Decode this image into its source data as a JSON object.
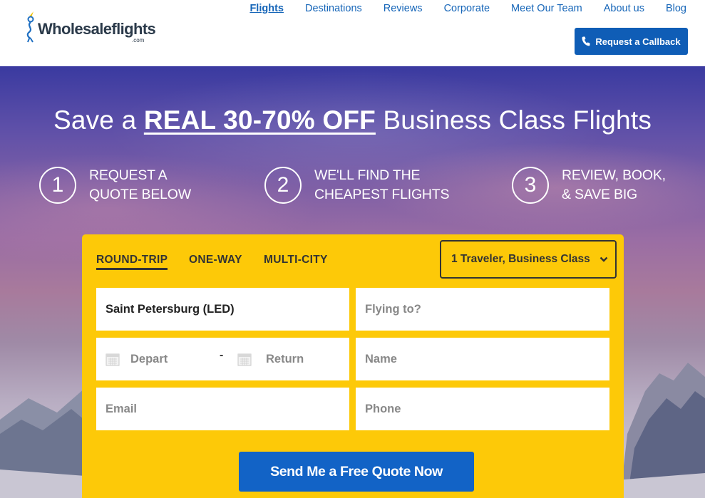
{
  "header": {
    "logo_text": "Wholesaleflights",
    "logo_sub": ".com",
    "nav": [
      {
        "label": "Flights",
        "active": true
      },
      {
        "label": "Destinations"
      },
      {
        "label": "Reviews"
      },
      {
        "label": "Corporate"
      },
      {
        "label": "Meet Our Team"
      },
      {
        "label": "About us"
      },
      {
        "label": "Blog"
      }
    ],
    "callback_label": "Request a Callback",
    "callback_icon": "phone-icon"
  },
  "hero": {
    "headline_pre": "Save a ",
    "headline_strong": "REAL 30-70% OFF",
    "headline_post": " Business Class Flights",
    "steps": [
      {
        "num": "1",
        "line1": "REQUEST A",
        "line2": "QUOTE BELOW"
      },
      {
        "num": "2",
        "line1": "WE'LL FIND THE",
        "line2": "CHEAPEST FLIGHTS"
      },
      {
        "num": "3",
        "line1": "REVIEW, BOOK,",
        "line2": "& SAVE BIG"
      }
    ]
  },
  "form": {
    "trip_types": [
      "ROUND-TRIP",
      "ONE-WAY",
      "MULTI-CITY"
    ],
    "selected_trip": "ROUND-TRIP",
    "travelers_value": "1 Traveler, Business Class",
    "from_value": "Saint Petersburg (LED)",
    "to_placeholder": "Flying to?",
    "depart_placeholder": "Depart",
    "date_separator": "-",
    "return_placeholder": "Return",
    "name_placeholder": "Name",
    "email_placeholder": "Email",
    "phone_placeholder": "Phone",
    "submit_label": "Send Me a Free Quote Now"
  },
  "colors": {
    "brand_blue": "#0f5db6",
    "panel_yellow": "#fdc908",
    "link_blue": "#1565b8"
  }
}
